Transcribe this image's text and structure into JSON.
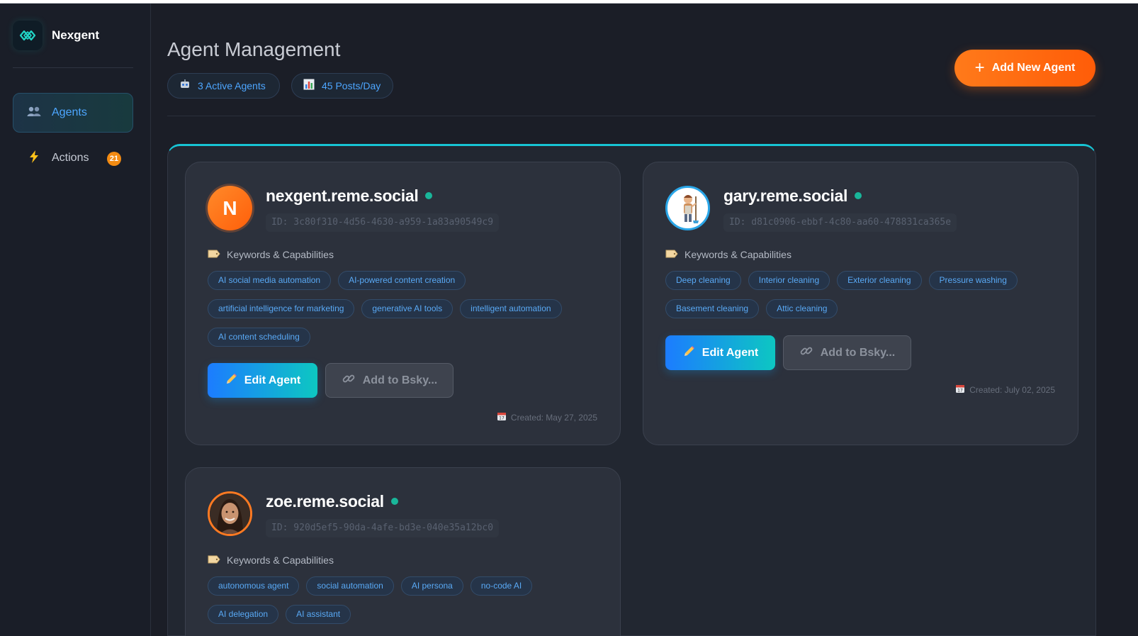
{
  "app": {
    "name": "Nexgent"
  },
  "sidebar": {
    "items": [
      {
        "label": "Agents",
        "icon": "users-icon",
        "active": true
      },
      {
        "label": "Actions",
        "icon": "lightning-icon",
        "badge": "21"
      }
    ]
  },
  "header": {
    "title": "Agent Management",
    "stats": [
      {
        "label": "3 Active Agents",
        "icon": "robot-icon"
      },
      {
        "label": "45 Posts/Day",
        "icon": "bar-chart-icon"
      }
    ],
    "add_button": "Add New Agent"
  },
  "section": {
    "keywords_header": "Keywords & Capabilities"
  },
  "buttons": {
    "edit": "Edit Agent",
    "bsky": "Add to Bsky..."
  },
  "agents": [
    {
      "name": "nexgent.reme.social",
      "id_text": "ID: 3c80f310-4d56-4630-a959-1a83a90549c9",
      "avatar_letter": "N",
      "keywords": [
        "AI social media automation",
        "AI-powered content creation",
        "artificial intelligence for marketing",
        "generative AI tools",
        "intelligent automation",
        "AI content scheduling"
      ],
      "created": "Created: May 27, 2025"
    },
    {
      "name": "gary.reme.social",
      "id_text": "ID: d81c0906-ebbf-4c80-aa60-478831ca365e",
      "keywords": [
        "Deep cleaning",
        "Interior cleaning",
        "Exterior cleaning",
        "Pressure washing",
        "Basement cleaning",
        "Attic cleaning"
      ],
      "created": "Created: July 02, 2025"
    },
    {
      "name": "zoe.reme.social",
      "id_text": "ID: 920d5ef5-90da-4afe-bd3e-040e35a12bc0",
      "keywords": [
        "autonomous agent",
        "social automation",
        "AI persona",
        "no-code AI",
        "AI delegation",
        "AI assistant"
      ]
    }
  ],
  "colors": {
    "accent_orange": "#ff6a10",
    "accent_blue": "#4da6ff",
    "accent_teal": "#17c4d4",
    "online": "#19b69a"
  }
}
